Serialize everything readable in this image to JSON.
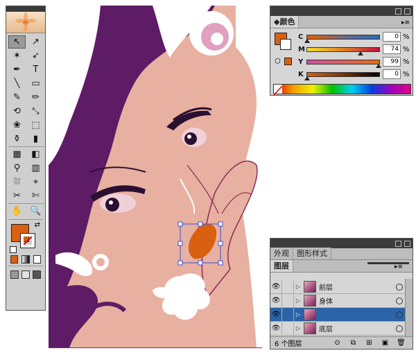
{
  "colors": {
    "fill": "#d86010",
    "skin": "#e8b0a0",
    "hair": "#5e1c66",
    "white": "#ffffff",
    "selection": "#3b4ecf",
    "panel": "#d6d6d6",
    "layerSelected": "#2b63a8"
  },
  "tools": [
    {
      "id": "selection",
      "icon": "selection-arrow-icon",
      "glyph": "↖",
      "selected": true
    },
    {
      "id": "direct-selection",
      "icon": "direct-selection-icon",
      "glyph": "↗"
    },
    {
      "id": "magic-wand",
      "icon": "magic-wand-icon",
      "glyph": "✶"
    },
    {
      "id": "lasso",
      "icon": "lasso-icon",
      "glyph": "➶"
    },
    {
      "id": "pen",
      "icon": "pen-tool-icon",
      "glyph": "✒"
    },
    {
      "id": "type",
      "icon": "type-tool-icon",
      "glyph": "T"
    },
    {
      "id": "line",
      "icon": "line-tool-icon",
      "glyph": "╲"
    },
    {
      "id": "rectangle",
      "icon": "rectangle-tool-icon",
      "glyph": "▭"
    },
    {
      "id": "paintbrush",
      "icon": "paintbrush-icon",
      "glyph": "✎"
    },
    {
      "id": "pencil",
      "icon": "pencil-icon",
      "glyph": "✏"
    },
    {
      "id": "rotate",
      "icon": "rotate-tool-icon",
      "glyph": "⟲"
    },
    {
      "id": "scale",
      "icon": "scale-tool-icon",
      "glyph": "⤡"
    },
    {
      "id": "warp",
      "icon": "warp-tool-icon",
      "glyph": "❀"
    },
    {
      "id": "free-transform",
      "icon": "free-transform-icon",
      "glyph": "⬚"
    },
    {
      "id": "symbol-sprayer",
      "icon": "symbol-sprayer-icon",
      "glyph": "⚱"
    },
    {
      "id": "column-graph",
      "icon": "column-graph-icon",
      "glyph": "▮"
    },
    {
      "id": "mesh",
      "icon": "mesh-tool-icon",
      "glyph": "▦"
    },
    {
      "id": "gradient",
      "icon": "gradient-tool-icon",
      "glyph": "◧"
    },
    {
      "id": "eyedropper",
      "icon": "eyedropper-icon",
      "glyph": "⚲"
    },
    {
      "id": "blend",
      "icon": "blend-tool-icon",
      "glyph": "▥"
    },
    {
      "id": "live-paint",
      "icon": "live-paint-bucket-icon",
      "glyph": "⛆"
    },
    {
      "id": "live-paint-select",
      "icon": "live-paint-select-icon",
      "glyph": "⌖"
    },
    {
      "id": "slice",
      "icon": "slice-tool-icon",
      "glyph": "✂"
    },
    {
      "id": "scissors",
      "icon": "scissors-icon",
      "glyph": "✄"
    },
    {
      "id": "hand",
      "icon": "hand-tool-icon",
      "glyph": "✋"
    },
    {
      "id": "zoom",
      "icon": "zoom-tool-icon",
      "glyph": "🔍"
    }
  ],
  "colorPanel": {
    "tab": "颜色",
    "channels": [
      {
        "label": "C",
        "value": "0",
        "unit": "%",
        "pos": 0.0,
        "gradient": "linear-gradient(90deg,#d86010,#d86010 10%,#5a6b9a 60%,#2a6bb0)"
      },
      {
        "label": "M",
        "value": "74",
        "unit": "%",
        "pos": 0.74,
        "gradient": "linear-gradient(90deg,#f0e030,#e08020,#c01040)"
      },
      {
        "label": "Y",
        "value": "99",
        "unit": "%",
        "pos": 0.99,
        "gradient": "linear-gradient(90deg,#d050a0,#e06060,#e07010)"
      },
      {
        "label": "K",
        "value": "0",
        "unit": "%",
        "pos": 0.0,
        "gradient": "linear-gradient(90deg,#d86010,#7a3008,#000)"
      }
    ]
  },
  "layersPanel": {
    "topTabs": [
      "外观",
      "图形样式"
    ],
    "tab": "图层",
    "layers": [
      {
        "name": "前层",
        "selected": false
      },
      {
        "name": "身体",
        "selected": false
      },
      {
        "name": "",
        "selected": true
      },
      {
        "name": "底层",
        "selected": false
      }
    ],
    "count": "6 个图层"
  }
}
